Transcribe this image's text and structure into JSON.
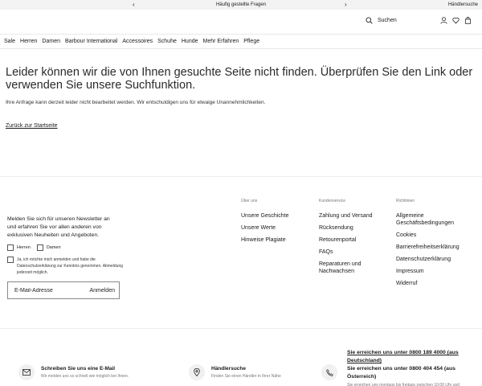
{
  "topbar": {
    "prev": "‹",
    "next": "›",
    "promo": "Häufig gestellte Fragen",
    "dealer": "Händlersuche"
  },
  "header": {
    "search_label": "Suchen",
    "icons": [
      "search-icon",
      "user-icon",
      "heart-icon",
      "bag-icon"
    ]
  },
  "nav": {
    "items": [
      "Sale",
      "Herren",
      "Damen",
      "Barbour International",
      "Accessoires",
      "Schuhe",
      "Hunde",
      "Mehr Erfahren",
      "Pflege"
    ]
  },
  "error": {
    "title": "Leider können wir die von Ihnen gesuchte Seite nicht finden. Überprüfen Sie den Link oder verwenden Sie unsere Suchfunktion.",
    "subtitle": "Ihre Anfrage kann derzeit leider nicht bearbeitet werden. Wir entschuldigen uns für etwaige Unannehmlichkeiten.",
    "back_link": "Zurück zur Startseite"
  },
  "newsletter": {
    "text": "Melden Sie sich für unseren Newsletter an und erfahren Sie vor allen anderen von exklusiven Neuheiten und Angeboten.",
    "option_men": "Herren",
    "option_women": "Damen",
    "consent": "Ja, ich möchte mich anmelden und habe die Datenschutzerklärung zur Kenntnis genommen. Abmeldung jederzeit möglich.",
    "email_placeholder": "E-Mail-Adresse",
    "submit": "Anmelden"
  },
  "footer": {
    "about": {
      "heading": "Über uns",
      "links": [
        "Unsere Geschichte",
        "Unsere Werte",
        "Hinweise Plagiate"
      ]
    },
    "service": {
      "heading": "Kundenservice",
      "links": [
        "Zahlung und Versand",
        "Rücksendung",
        "Retourenportal",
        "FAQs",
        "Reparaturen und Nachwachsen"
      ]
    },
    "legal": {
      "heading": "Richtlinien",
      "links": [
        "Allgemeine Geschäftsbedingungen",
        "Cookies",
        "Barrierefreiheitserklärung",
        "Datenschutzerklärung",
        "Impressum",
        "Widerruf"
      ]
    }
  },
  "contact": {
    "email_title": "Schreiben Sie uns eine E-Mail",
    "email_desc": "Wir melden uns so schnell wie möglich bei Ihnen.",
    "dealer_title": "Händlersuche",
    "dealer_desc": "Finden Sie einen Händler in Ihrer Nähe",
    "phone_de": "Sie erreichen uns unter 0800 189 4000 (aus Deutschland)",
    "phone_at": "Sie erreichen uns unter 0800 404 454 (aus Österreich)",
    "phone_note": "Sie erreichen uns montags bis freitags zwischen 10:00 Uhr und"
  }
}
